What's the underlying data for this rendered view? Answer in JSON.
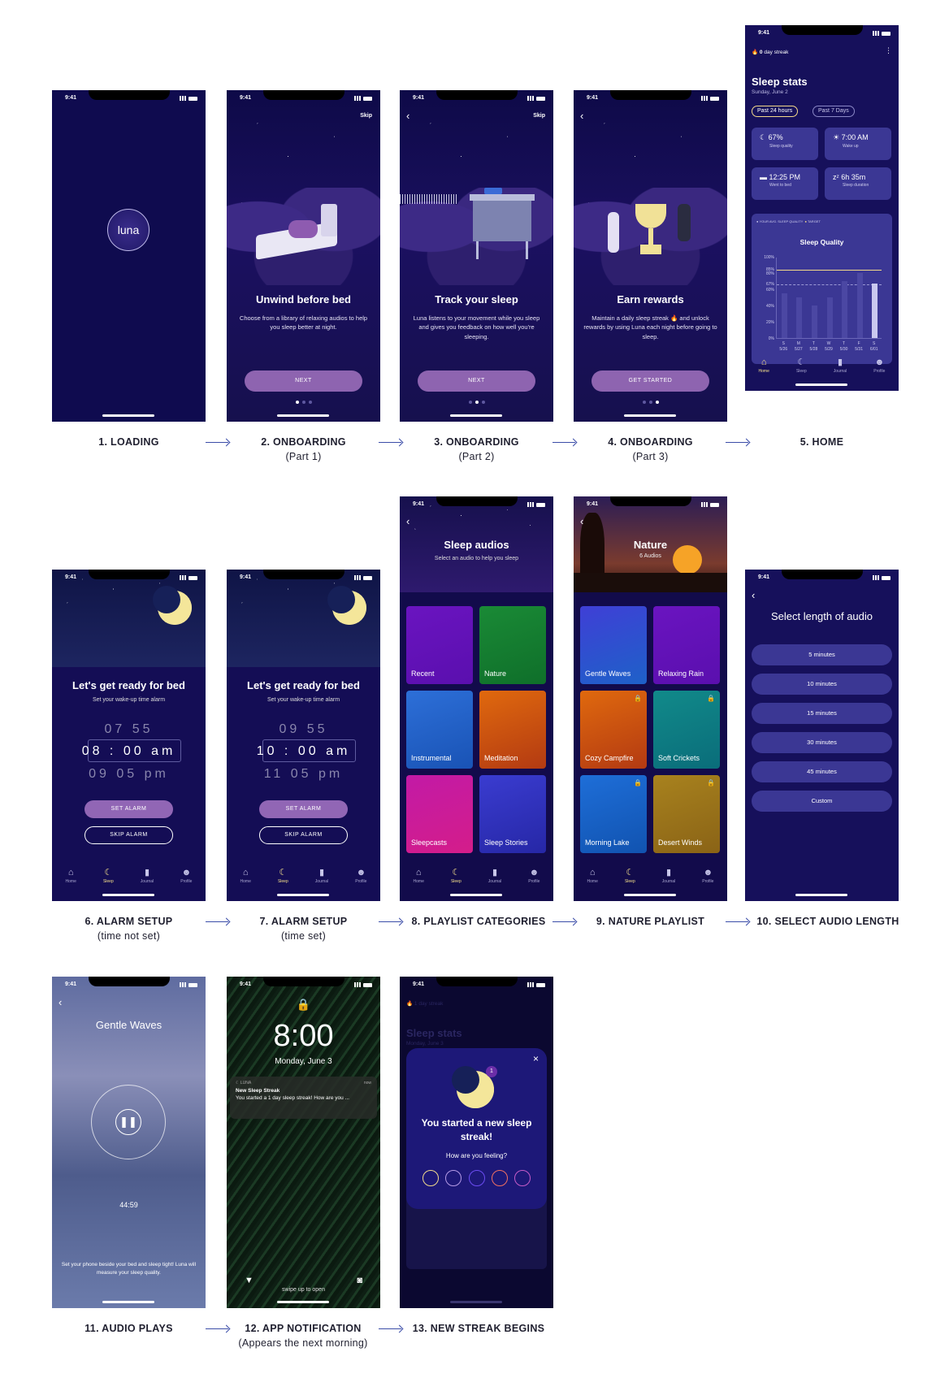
{
  "status_time": "9:41",
  "captions": [
    {
      "title": "1. LOADING",
      "sub": ""
    },
    {
      "title": "2. ONBOARDING",
      "sub": "(Part 1)"
    },
    {
      "title": "3. ONBOARDING",
      "sub": "(Part 2)"
    },
    {
      "title": "4. ONBOARDING",
      "sub": "(Part 3)"
    },
    {
      "title": "5. HOME",
      "sub": ""
    },
    {
      "title": "6. ALARM SETUP",
      "sub": "(time not set)"
    },
    {
      "title": "7. ALARM SETUP",
      "sub": "(time set)"
    },
    {
      "title": "8. PLAYLIST CATEGORIES",
      "sub": ""
    },
    {
      "title": "9. NATURE PLAYLIST",
      "sub": ""
    },
    {
      "title": "10. SELECT AUDIO LENGTH",
      "sub": ""
    },
    {
      "title": "11. AUDIO PLAYS",
      "sub": ""
    },
    {
      "title": "12. APP NOTIFICATION",
      "sub": "(Appears the next morning)"
    },
    {
      "title": "13. NEW STREAK BEGINS",
      "sub": ""
    }
  ],
  "loading": {
    "logo": "luna"
  },
  "onboarding": {
    "skip": "Skip",
    "p1": {
      "title": "Unwind before bed",
      "desc": "Choose from a library of relaxing audios to help you sleep better at night.",
      "button": "NEXT"
    },
    "p2": {
      "title": "Track your sleep",
      "desc": "Luna listens to your movement while you sleep and gives you feedback on how well you're sleeping.",
      "button": "NEXT"
    },
    "p3": {
      "title": "Earn rewards",
      "desc": "Maintain a daily sleep streak 🔥 and unlock rewards by using Luna each night before going to sleep.",
      "button": "GET STARTED"
    }
  },
  "home": {
    "streak_count": "0",
    "streak_label": "day streak",
    "title": "Sleep stats",
    "date": "Sunday, June 2",
    "chips": [
      "Past 24 hours",
      "Past 7 Days"
    ],
    "cards": [
      {
        "value": "67%",
        "label": "Sleep quality",
        "icon": "moon-icon"
      },
      {
        "value": "7:00 AM",
        "label": "Wake up",
        "icon": "sun-icon"
      },
      {
        "value": "12:25 PM",
        "label": "Went to bed",
        "icon": "bed-icon"
      },
      {
        "value": "6h 35m",
        "label": "Sleep duration",
        "icon": "zz-icon"
      }
    ],
    "legend": [
      "YOUR AVG. SLEEP QUALITY",
      "TARGET"
    ]
  },
  "chart_data": {
    "type": "bar",
    "title": "Sleep Quality",
    "categories": [
      "S 5/26",
      "M 5/27",
      "T 5/28",
      "W 5/29",
      "T 5/30",
      "F 5/31",
      "S 6/01"
    ],
    "day_letters": [
      "S",
      "M",
      "T",
      "W",
      "T",
      "F",
      "S"
    ],
    "dates": [
      "5/26",
      "5/27",
      "5/28",
      "5/29",
      "5/30",
      "5/31",
      "6/01"
    ],
    "values": [
      55,
      50,
      40,
      50,
      70,
      80,
      67
    ],
    "yticks": [
      "100%",
      "85%",
      "80%",
      "67%",
      "60%",
      "40%",
      "20%",
      "0%"
    ],
    "ylim": [
      0,
      100
    ],
    "target": 85,
    "average": 67
  },
  "tabs": [
    "Home",
    "Sleep",
    "Journal",
    "Profile"
  ],
  "alarm": {
    "title": "Let's get ready for bed",
    "subtitle": "Set your wake-up time alarm",
    "not_set": {
      "above": [
        "07",
        "55"
      ],
      "selected": [
        "08",
        "00",
        "am"
      ],
      "below": [
        "09",
        "05",
        "pm"
      ]
    },
    "set": {
      "above": [
        "09",
        "55"
      ],
      "selected": [
        "10",
        "00",
        "am"
      ],
      "below": [
        "11",
        "05",
        "pm"
      ]
    },
    "set_button": "SET ALARM",
    "skip_button": "SKIP ALARM"
  },
  "playlists": {
    "title": "Sleep audios",
    "subtitle": "Select an audio to help you sleep",
    "tiles": [
      "Recent",
      "Nature",
      "Instrumental",
      "Meditation",
      "Sleepcasts",
      "Sleep Stories"
    ]
  },
  "nature": {
    "title": "Nature",
    "subtitle": "6 Audios",
    "tiles": [
      "Gentle  Waves",
      "Relaxing Rain",
      "Cozy Campfire",
      "Soft Crickets",
      "Morning Lake",
      "Desert Winds"
    ]
  },
  "length": {
    "title": "Select length of audio",
    "options": [
      "5 minutes",
      "10 minutes",
      "15 minutes",
      "30 minutes",
      "45 minutes",
      "Custom"
    ]
  },
  "player": {
    "title": "Gentle Waves",
    "time": "44:59",
    "hint": "Set your phone beside your bed and sleep tight! Luna will measure your sleep quality."
  },
  "lockscreen": {
    "time": "8:00",
    "date": "Monday, June 3",
    "app": "LUNA",
    "when": "now",
    "notif_title": "New Sleep Streak",
    "notif_body": "You started a 1 day sleep streak! How are you ...",
    "swipe": "swipe up to open"
  },
  "streak": {
    "badge": "1",
    "title": "You started a new sleep streak!",
    "question": "How are you feeling?",
    "bg_streak": "1 day streak",
    "bg_title": "Sleep stats",
    "bg_date": "Monday, June 3"
  },
  "colors": {
    "bg": "#120b4b",
    "card": "#3b3794",
    "accent": "#8e64b0",
    "moon": "#f4e69a",
    "arrow": "#3b4da8"
  }
}
